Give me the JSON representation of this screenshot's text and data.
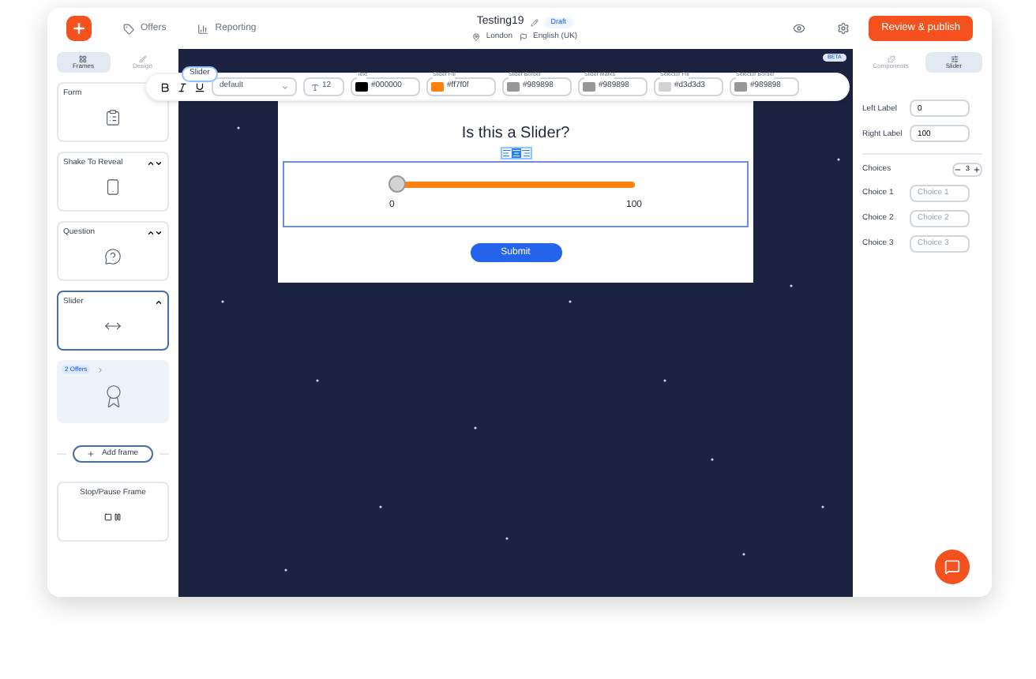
{
  "header": {
    "nav": [
      {
        "label": "Offers"
      },
      {
        "label": "Reporting"
      }
    ],
    "title": "Testing19",
    "status": "Draft",
    "location": "London",
    "language": "English (UK)",
    "publish": "Review & publish"
  },
  "left_tabs": [
    {
      "label": "Frames",
      "selected": true
    },
    {
      "label": "Design",
      "selected": false
    }
  ],
  "frames": [
    {
      "kind": "frame",
      "title": "Form",
      "selected": false
    },
    {
      "kind": "frame",
      "title": "Shake To Reveal",
      "up": true,
      "down": true,
      "selected": false
    },
    {
      "kind": "frame",
      "title": "Question",
      "up": true,
      "down": true,
      "selected": false
    },
    {
      "kind": "frame",
      "title": "Slider",
      "up": true,
      "down": false,
      "selected": true
    },
    {
      "kind": "offers",
      "badge": "2 Offers",
      "selected": false
    }
  ],
  "add_frame": "Add frame",
  "stop_frame": {
    "title": "Stop/Pause Frame"
  },
  "toolbar": {
    "element": "Slider",
    "font": "default",
    "size": "12",
    "colors": [
      {
        "label": "Text",
        "value": "#000000"
      },
      {
        "label": "Slider Fill",
        "value": "#ff7f0f"
      },
      {
        "label": "Slider Border",
        "value": "#989898"
      },
      {
        "label": "Slider Marks",
        "value": "#989898"
      },
      {
        "label": "Selector Fill",
        "value": "#d3d3d3"
      },
      {
        "label": "Selector Border",
        "value": "#989898"
      }
    ]
  },
  "beta": "BETA",
  "card": {
    "question": "Is this a Slider?",
    "slider": {
      "level": 0,
      "min": "0",
      "max": "100"
    },
    "submit": "Submit"
  },
  "right_tabs": [
    {
      "label": "Components",
      "selected": false
    },
    {
      "label": "Slider",
      "selected": true
    }
  ],
  "settings": {
    "left_label": {
      "label": "Left Label",
      "value": "0"
    },
    "right_label": {
      "label": "Right Label",
      "value": "100"
    },
    "choices_label": "Choices",
    "choices_count": "3",
    "choices": [
      {
        "label": "Choice 1",
        "placeholder": "Choice 1"
      },
      {
        "label": "Choice 2",
        "placeholder": "Choice 2"
      },
      {
        "label": "Choice 3",
        "placeholder": "Choice 3"
      }
    ]
  }
}
